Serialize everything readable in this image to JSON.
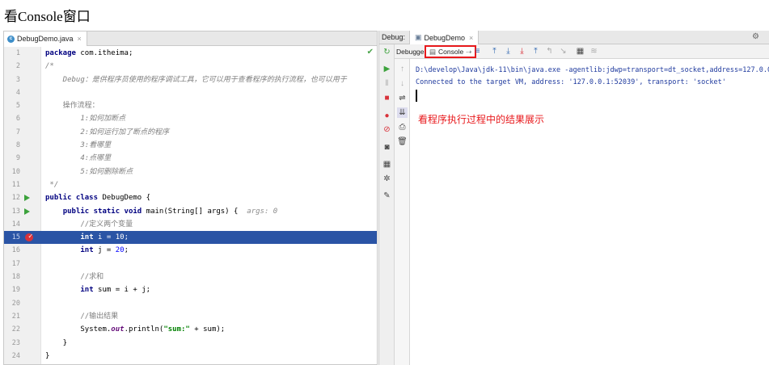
{
  "page_title": "看Console窗口",
  "editor": {
    "tab_label": "DebugDemo.java",
    "tab_icon_letter": "c",
    "code": {
      "l1": {
        "kw": "package",
        "rest": " com.itheima;"
      },
      "l2": "/*",
      "l3": "    Debug：是供程序员使用的程序调试工具，它可以用于查看程序的执行流程，也可以用于",
      "l5": "    操作流程：",
      "l6": "        1:如何加断点",
      "l7": "        2:如何运行加了断点的程序",
      "l8": "        3:看哪里",
      "l9": "        4:点哪里",
      "l10": "        5:如何删除断点",
      "l11": " */",
      "l12": {
        "kw": "public class",
        "rest": " DebugDemo {"
      },
      "l13": {
        "indent": "    ",
        "kw": "public static void",
        "rest": " main(String[] args) {  ",
        "hint": "args: 0"
      },
      "l14": "        //定义两个变量",
      "l15": {
        "indent": "        ",
        "kw": "int",
        "rest": " i = ",
        "num": "10",
        "end": ";"
      },
      "l16": {
        "indent": "        ",
        "kw": "int",
        "rest": " j = ",
        "num": "20",
        "end": ";"
      },
      "l18": "        //求和",
      "l19": {
        "indent": "        ",
        "kw": "int",
        "rest": " sum = i + j;"
      },
      "l21": "        //输出结果",
      "l22": {
        "indent": "        ",
        "pre": "System.",
        "field": "out",
        "mid": ".println(",
        "str": "\"sum:\"",
        "end": " + sum);"
      },
      "l23": "    }",
      "l24": "}"
    }
  },
  "debug": {
    "label": "Debug:",
    "session_tab": "DebugDemo",
    "debugger_tab": "Debugger",
    "console_tab": "Console",
    "console_tab_suffix": "⇢",
    "console_lines": [
      "D:\\develop\\Java\\jdk-11\\bin\\java.exe -agentlib:jdwp=transport=dt_socket,address=127.0.0",
      "Connected to the target VM, address: '127.0.0.1:52039', transport: 'socket'"
    ],
    "annotation": "看程序执行过程中的结果展示"
  },
  "colors": {
    "highlight_line": "#2a54a5",
    "annotation_red": "#e8191c",
    "keyword": "#000080",
    "console_text": "#1f3a9e"
  }
}
